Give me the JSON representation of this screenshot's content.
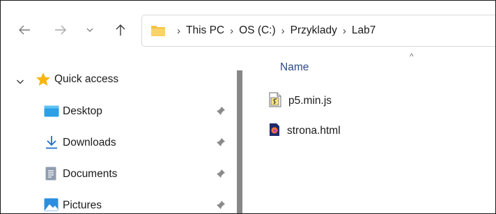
{
  "navigation": {
    "back_icon": "back-arrow-icon",
    "forward_icon": "forward-arrow-icon",
    "recent_icon": "chevron-down-icon",
    "up_icon": "up-arrow-icon"
  },
  "address_bar": {
    "folder_icon": "folder-icon",
    "separator": "›",
    "crumbs": [
      "This PC",
      "OS (C:)",
      "Przyklady",
      "Lab7"
    ]
  },
  "sidebar": {
    "quick_access": {
      "label": "Quick access",
      "expand_icon": "chevron-down-icon",
      "icon": "star-icon"
    },
    "items": [
      {
        "label": "Desktop",
        "icon": "desktop-icon",
        "pinned": true
      },
      {
        "label": "Downloads",
        "icon": "download-arrow-icon",
        "pinned": true
      },
      {
        "label": "Documents",
        "icon": "document-icon",
        "pinned": true
      },
      {
        "label": "Pictures",
        "icon": "pictures-icon",
        "pinned": true
      }
    ]
  },
  "file_list": {
    "column_header": "Name",
    "sort_indicator": "^",
    "files": [
      {
        "name": "p5.min.js",
        "icon": "javascript-file-icon"
      },
      {
        "name": "strona.html",
        "icon": "firefox-html-file-icon"
      }
    ]
  },
  "colors": {
    "folder_yellow": "#f5c242",
    "star_yellow": "#f9b610",
    "link_blue": "#2c4b8a",
    "download_blue": "#1f6fd0",
    "scrollbar_thumb": "#878787"
  }
}
